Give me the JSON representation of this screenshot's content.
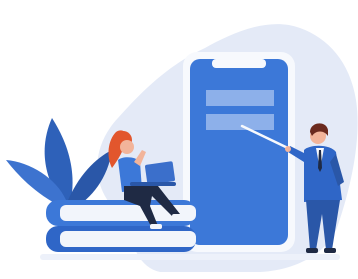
{
  "illustration": {
    "phone": {
      "text_lines_shown": 2
    },
    "book_stack_count": 2
  },
  "colors": {
    "blob": "#E4EAF7",
    "phone_body": "#3C78D8",
    "phone_frame": "#F7F9FD",
    "text_placeholder": "#8DB0EA",
    "leaves": "#2E61B9",
    "suit": "#2F66C7",
    "hair_woman": "#E2562D",
    "hair_man": "#6B2A1E",
    "skin": "#F2B49A",
    "laptop": "#3B6FCB",
    "pants_woman": "#1F2A44"
  }
}
